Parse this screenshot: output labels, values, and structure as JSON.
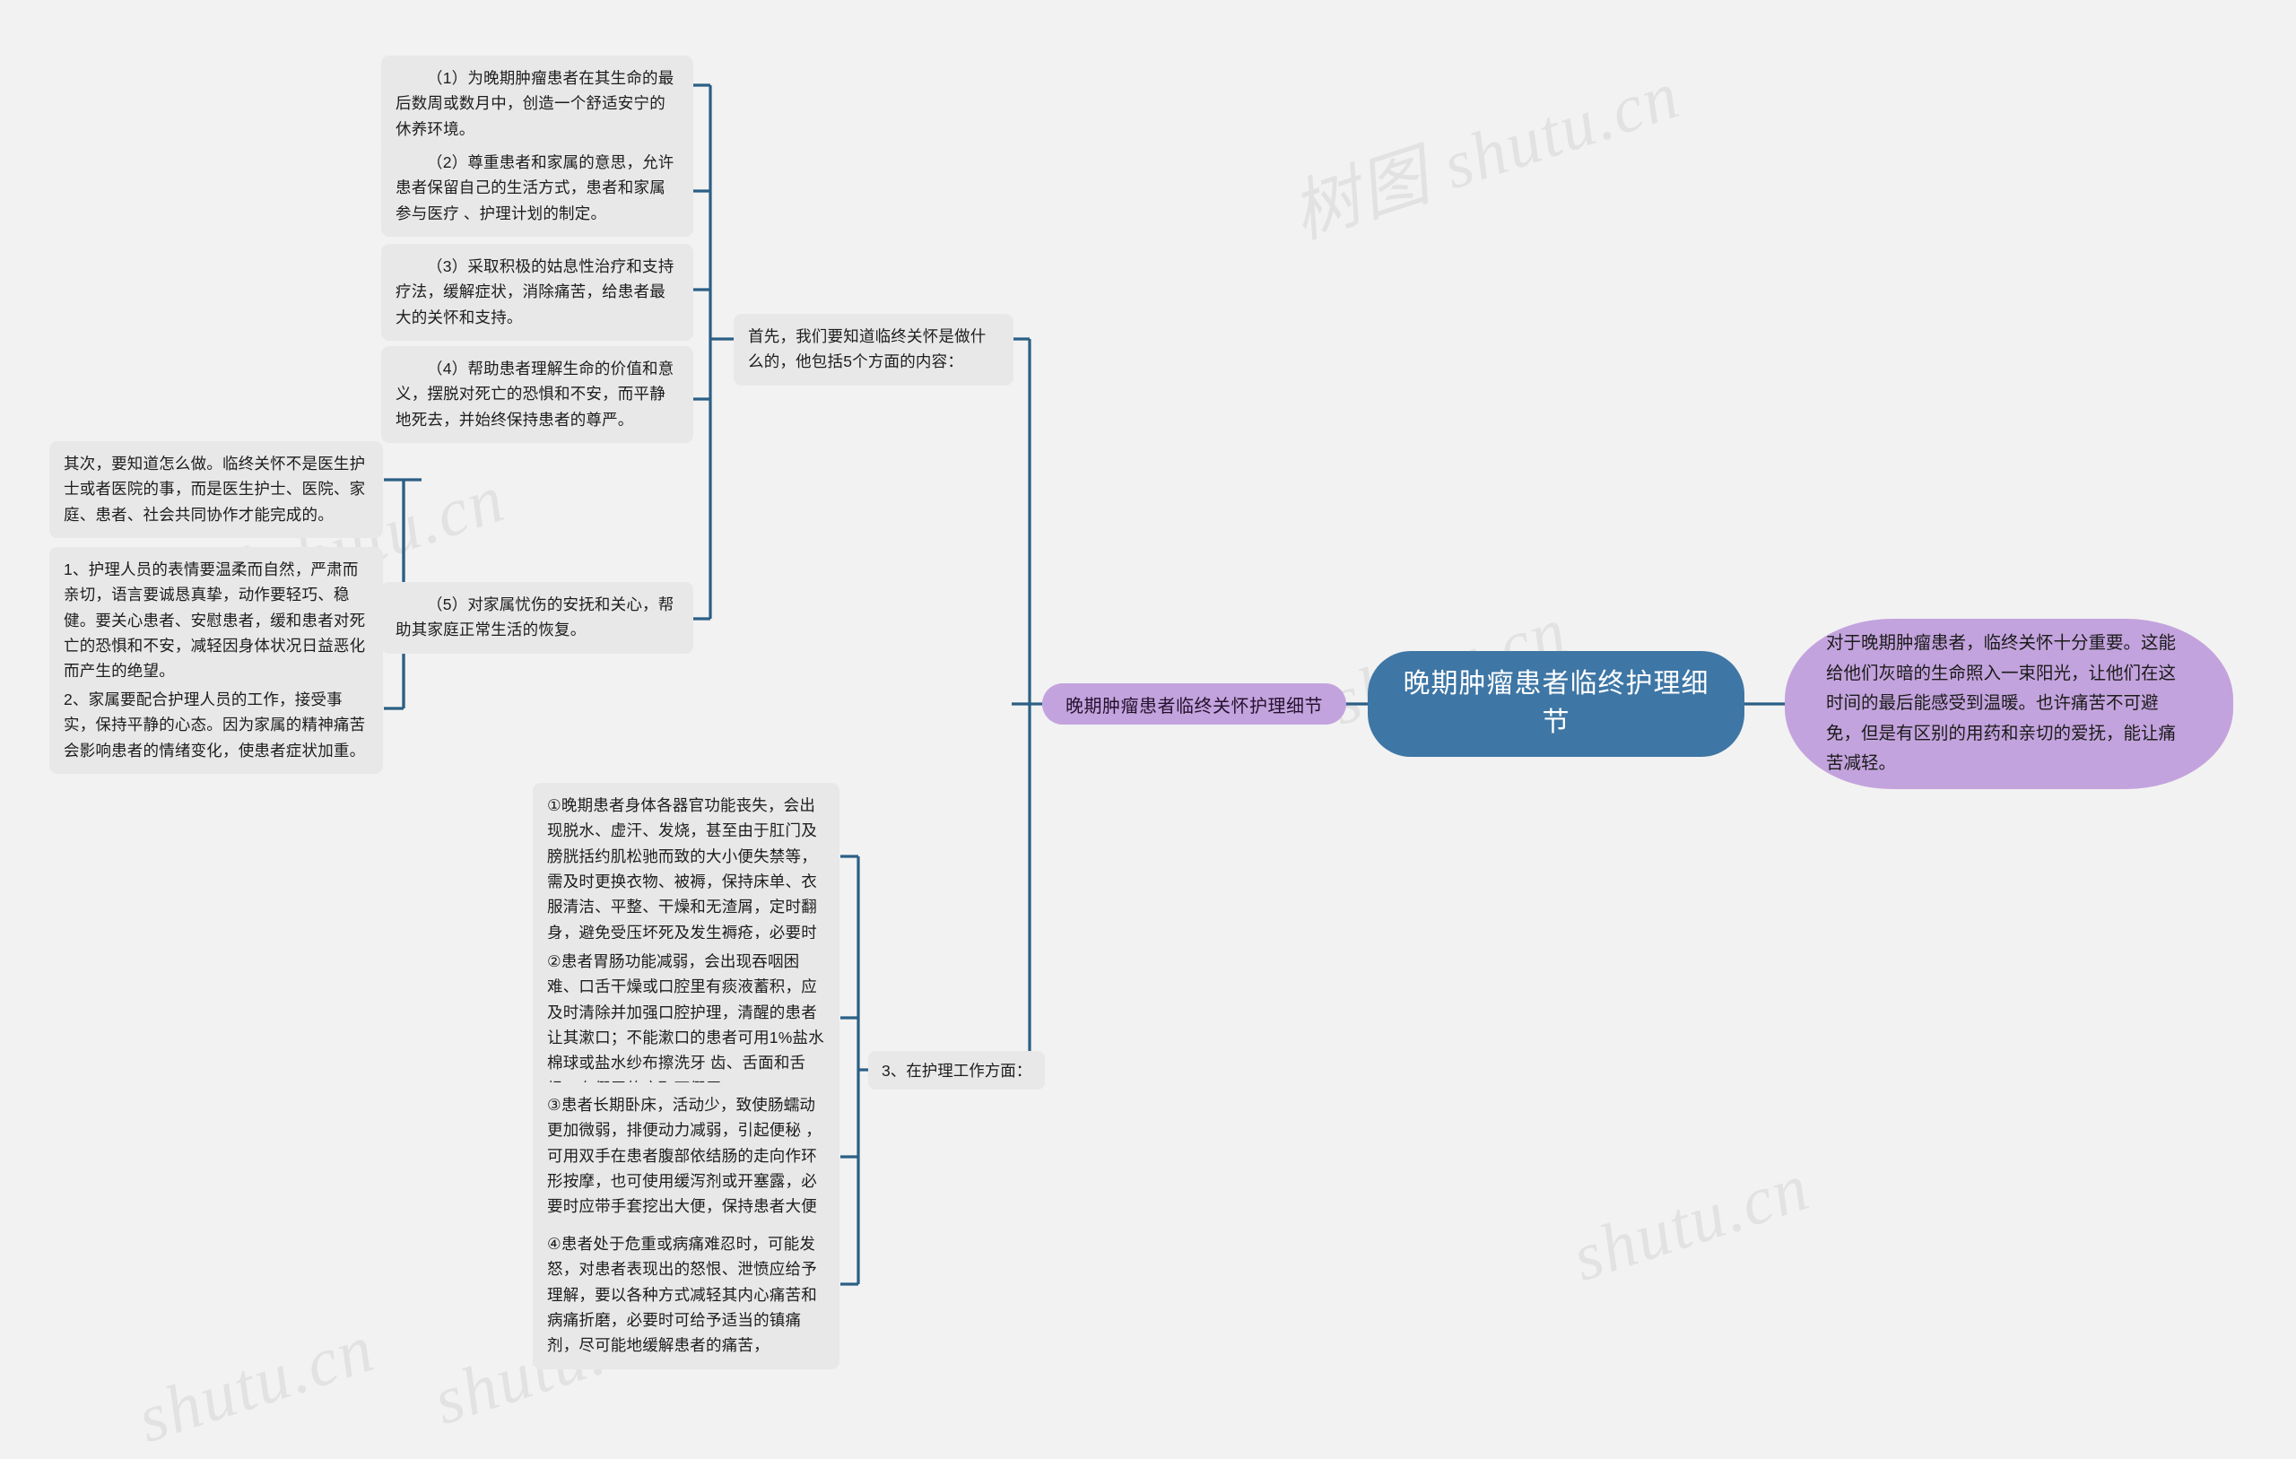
{
  "watermarks": {
    "a": "树图 shutu.cn",
    "b": "树图 shutu.cn",
    "c": "shutu.cn",
    "d": "shutu.cn",
    "e": "shutu.cn",
    "f": "shutu.cn"
  },
  "colors": {
    "background": "#f2f2f2",
    "root_fill": "#3e76a5",
    "branch_fill": "#c3a3dd",
    "leaf_fill": "#e8e8e8",
    "connector": "#2b5f85",
    "root_text": "#ffffff",
    "leaf_text": "#1d1d1d"
  },
  "root": {
    "label": "晚期肿瘤患者临终护理细节"
  },
  "summary": {
    "label": "对于晚期肿瘤患者，临终关怀十分重要。这能给他们灰暗的生命照入一束阳光，让他们在这时间的最后能感受到温暖。也许痛苦不可避免，但是有区别的用药和亲切的爱抚，能让痛苦减轻。"
  },
  "branch": {
    "label": "晚期肿瘤患者临终关怀护理细节"
  },
  "groups": [
    {
      "key": "first",
      "label": "首先，我们要知道临终关怀是做什么的，他包括5个方面的内容：",
      "items": [
        "（1）为晚期肿瘤患者在其生命的最后数周或数月中，创造一个舒适安宁的休养环境。",
        "（2）尊重患者和家属的意思，允许患者保留自己的生活方式，患者和家属参与医疗 、护理计划的制定。",
        "（3）采取积极的姑息性治疗和支持疗法，缓解症状，消除痛苦，给患者最大的关怀和支持。",
        "（4）帮助患者理解生命的价值和意义，摆脱对死亡的恐惧和不安，而平静地死去，并始终保持患者的尊严。",
        "（5）对家属忧伤的安抚和关心，帮助其家庭正常生活的恢复。"
      ]
    },
    {
      "key": "second",
      "label": "其次，要知道怎么做。临终关怀不是医生护士或者医院的事，而是医生护士、医院、家庭、患者、社会共同协作才能完成的。",
      "items": [
        "1、护理人员的表情要温柔而自然，严肃而亲切，语言要诚恳真挚，动作要轻巧、稳健。要关心患者、安慰患者，缓和患者对死亡的恐惧和不安，减轻因身体状况日益恶化而产生的绝望。",
        "2、家属要配合护理人员的工作，接受事实，保持平静的心态。因为家属的精神痛苦会影响患者的情绪变化，使患者症状加重。"
      ]
    },
    {
      "key": "third",
      "label": "3、在护理工作方面：",
      "items": [
        "①晚期患者身体各器官功能丧失，会出现脱水、虚汗、发烧，甚至由于肛门及膀胱括约肌松驰而致的大小便失禁等，需及时更换衣物、被褥，保持床单、衣服清洁、平整、干燥和无渣屑，定时翻身，避免受压坏死及发生褥疮，必要时骨突出处可垫海绵垫或气圈。",
        "②患者胃肠功能减弱，会出现吞咽困难、口舌干燥或口腔里有痰液蓄积，应及时清除并加强口腔护理，清醒的患者让其漱口；不能漱口的患者可用1%盐水棉球或盐水纱布擦洗牙 齿、舌面和舌根；有假牙的应取下假牙。",
        "③患者长期卧床，活动少，致使肠蠕动更加微弱，排便动力减弱，引起便秘 ，可用双手在患者腹部依结肠的走向作环形按摩，也可使用缓泻剂或开塞露，必要时应带手套挖出大便，保持患者大便通畅。",
        "④患者处于危重或病痛难忍时，可能发怒，对患者表现出的怒恨、泄愤应给予理解，要以各种方式减轻其内心痛苦和病痛折磨，必要时可给予适当的镇痛剂，尽可能地缓解患者的痛苦，"
      ]
    }
  ]
}
